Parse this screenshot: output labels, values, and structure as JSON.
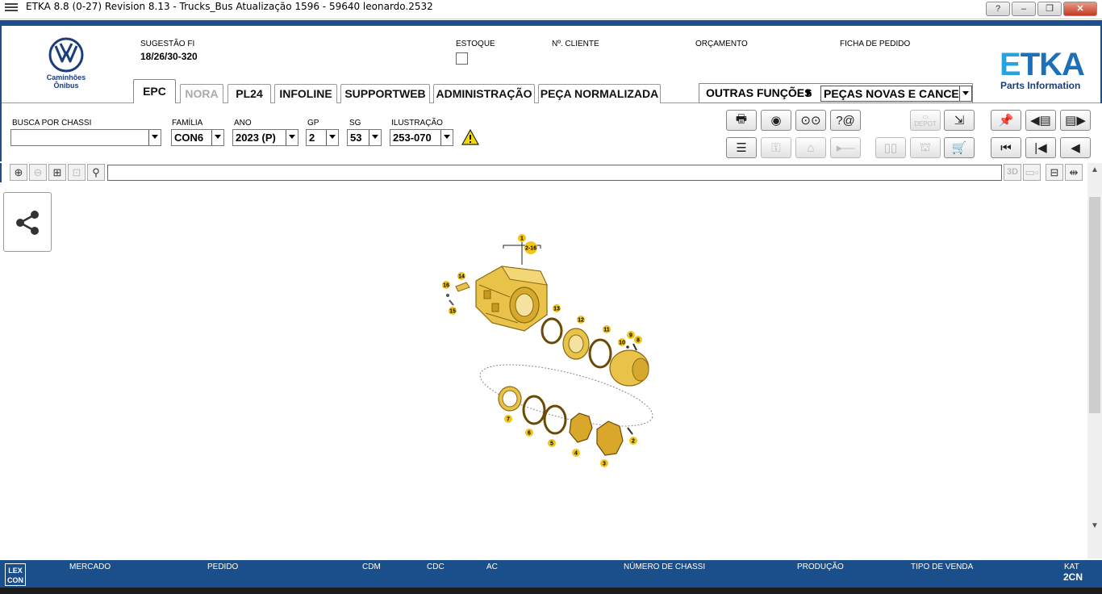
{
  "window": {
    "title": "ETKA 8.8 (0-27) Revision 8.13 - Trucks_Bus Atualização 1596 - 59640 leonardo.2532",
    "buttons": [
      "?",
      "–",
      "❐",
      "✕"
    ]
  },
  "brand": {
    "vw_text_line1": "Caminhões",
    "vw_text_line2": "Ônibus",
    "etka_logo_e": "E",
    "etka_logo_rest": "TKA",
    "etka_sub": "Parts Information"
  },
  "header": {
    "sugestao_label": "SUGESTÃO FI",
    "sugestao_value": "18/26/30-320",
    "estoque_label": "ESTOQUE",
    "cliente_label": "Nº. CLIENTE",
    "orcamento_label": "ORÇAMENTO",
    "ficha_label": "FICHA DE PEDIDO"
  },
  "tabs": [
    {
      "label": "EPC",
      "state": "active"
    },
    {
      "label": "NORA",
      "state": "disabled"
    },
    {
      "label": "PL24",
      "state": "normal"
    },
    {
      "label": "INFOLINE",
      "state": "normal"
    },
    {
      "label": "SUPPORTWEB",
      "state": "normal"
    },
    {
      "label": "ADMINISTRAÇÃO",
      "state": "normal"
    },
    {
      "label": "PEÇA NORMALIZADA",
      "state": "normal"
    }
  ],
  "outras": {
    "label": "OUTRAS FUNÇÕES",
    "selected": "PEÇAS NOVAS E CANCEL."
  },
  "selectors": {
    "chassi_label": "BUSCA POR CHASSI",
    "chassi_value": "",
    "familia_label": "FAMÍLIA",
    "familia_value": "CON6",
    "ano_label": "ANO",
    "ano_value": "2023 (P)",
    "gp_label": "GP",
    "gp_value": "2",
    "sg_label": "SG",
    "sg_value": "53",
    "ilustracao_label": "ILUSTRAÇÃO",
    "ilustracao_value": "253-070"
  },
  "toolbar": {
    "depot_label": "DEPOT",
    "view_3d": "3D"
  },
  "diagram": {
    "callouts": [
      "1",
      "2-16",
      "14",
      "16",
      "15",
      "13",
      "12",
      "11",
      "9",
      "8",
      "10",
      "7",
      "6",
      "5",
      "4",
      "3",
      "2"
    ]
  },
  "status": {
    "lexcon_line1": "LEX",
    "lexcon_line2": "CON",
    "mercado": "MERCADO",
    "pedido": "PEDIDO",
    "cdm": "CDM",
    "cdc": "CDC",
    "ac": "AC",
    "numero_chassi": "NÚMERO DE CHASSI",
    "producao": "PRODUÇÃO",
    "tipo_venda": "TIPO DE VENDA",
    "kat_label": "KAT",
    "kat_value": "2CN"
  },
  "colors": {
    "brand_blue": "#1b4f8c",
    "part_gold": "#e9c24a",
    "callout_yellow": "#f0c419"
  }
}
